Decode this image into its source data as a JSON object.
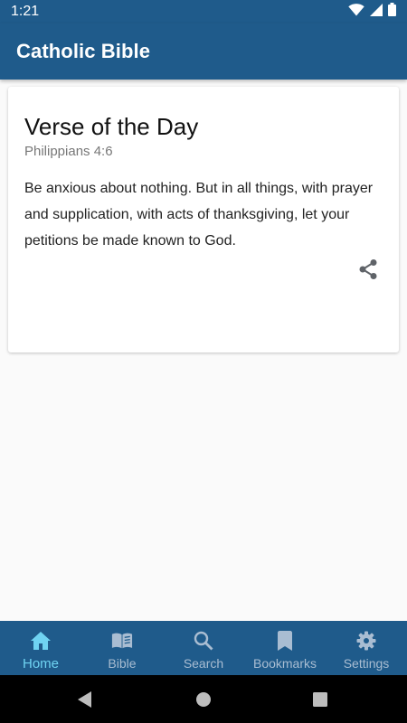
{
  "status_bar": {
    "time": "1:21"
  },
  "app_bar": {
    "title": "Catholic Bible"
  },
  "verse_card": {
    "title": "Verse of the Day",
    "reference": "Philippians 4:6",
    "text": "Be anxious about nothing. But in all things, with prayer and supplication, with acts of thanksgiving, let your petitions be made known to God."
  },
  "bottom_nav": {
    "items": [
      {
        "label": "Home",
        "icon": "home-icon",
        "active": true
      },
      {
        "label": "Bible",
        "icon": "book-icon",
        "active": false
      },
      {
        "label": "Search",
        "icon": "search-icon",
        "active": false
      },
      {
        "label": "Bookmarks",
        "icon": "bookmark-icon",
        "active": false
      },
      {
        "label": "Settings",
        "icon": "gear-icon",
        "active": false
      }
    ]
  },
  "colors": {
    "primary": "#1f5b8b",
    "nav_active": "#6fd3f2",
    "nav_inactive": "#a9bdd2",
    "background": "#fafafa"
  }
}
